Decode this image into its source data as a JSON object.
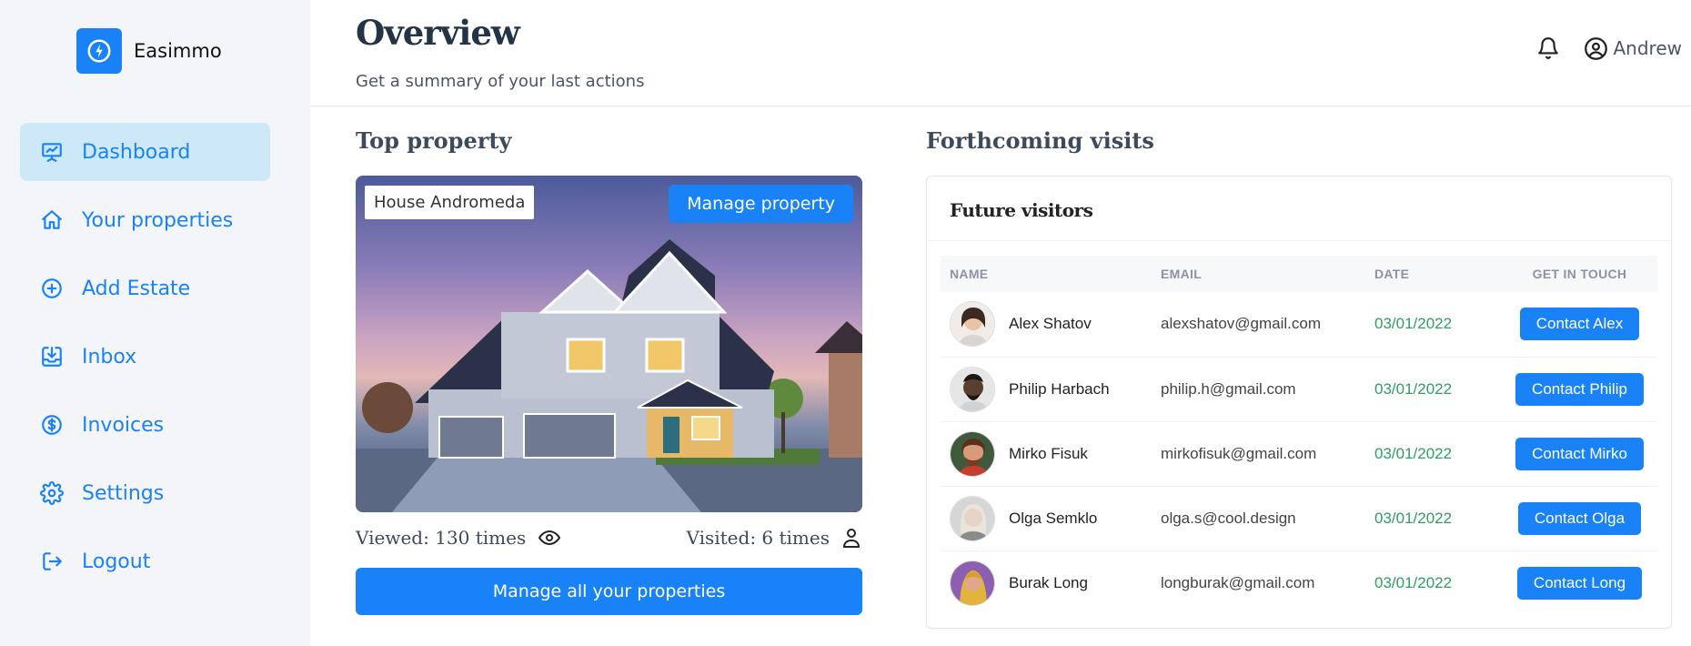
{
  "brand": {
    "name": "Easimmo"
  },
  "sidebar": {
    "items": [
      {
        "label": "Dashboard",
        "icon": "chart-board-icon",
        "active": true
      },
      {
        "label": "Your properties",
        "icon": "home-icon",
        "active": false
      },
      {
        "label": "Add Estate",
        "icon": "plus-circle-icon",
        "active": false
      },
      {
        "label": "Inbox",
        "icon": "inbox-icon",
        "active": false
      },
      {
        "label": "Invoices",
        "icon": "dollar-circle-icon",
        "active": false
      },
      {
        "label": "Settings",
        "icon": "gear-icon",
        "active": false
      },
      {
        "label": "Logout",
        "icon": "logout-icon",
        "active": false
      }
    ]
  },
  "header": {
    "title": "Overview",
    "subtitle": "Get a summary of your last actions",
    "user_name": "Andrew"
  },
  "top_property": {
    "section_title": "Top property",
    "name": "House Andromeda",
    "manage_label": "Manage property",
    "viewed": "Viewed: 130 times",
    "visited": "Visited: 6 times",
    "manage_all_label": "Manage all your properties"
  },
  "visits": {
    "section_title": "Forthcoming visits",
    "card_title": "Future visitors",
    "columns": [
      "NAME",
      "EMAIL",
      "DATE",
      "GET IN TOUCH"
    ],
    "rows": [
      {
        "name": "Alex Shatov",
        "email": "alexshatov@gmail.com",
        "date": "03/01/2022",
        "contact": "Contact Alex",
        "avatar_color": "#d9b99b"
      },
      {
        "name": "Philip Harbach",
        "email": "philip.h@gmail.com",
        "date": "03/01/2022",
        "contact": "Contact Philip",
        "avatar_color": "#5a3f2e"
      },
      {
        "name": "Mirko Fisuk",
        "email": "mirkofisuk@gmail.com",
        "date": "03/01/2022",
        "contact": "Contact Mirko",
        "avatar_color": "#b5533c"
      },
      {
        "name": "Olga Semklo",
        "email": "olga.s@cool.design",
        "date": "03/01/2022",
        "contact": "Contact Olga",
        "avatar_color": "#c9c9c9"
      },
      {
        "name": "Burak Long",
        "email": "longburak@gmail.com",
        "date": "03/01/2022",
        "contact": "Contact Long",
        "avatar_color": "#e0b83c"
      }
    ]
  },
  "colors": {
    "accent": "#1a82f7",
    "active_nav_bg": "#cde9f7",
    "date_green": "#2f9e63"
  }
}
